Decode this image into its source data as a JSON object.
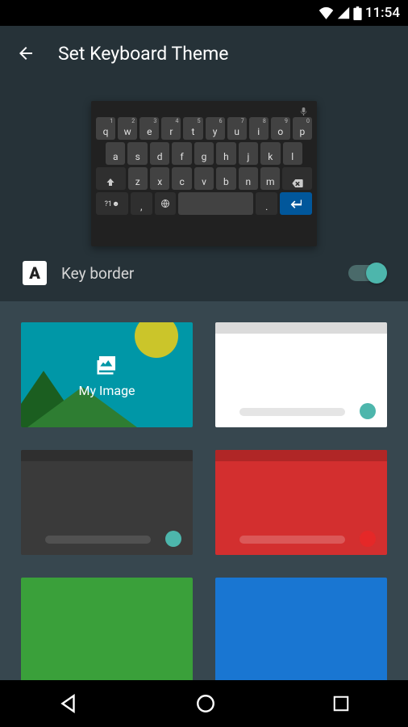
{
  "status": {
    "time": "11:54"
  },
  "header": {
    "title": "Set Keyboard Theme"
  },
  "keyboard": {
    "row1": [
      {
        "main": "q",
        "sup": "1"
      },
      {
        "main": "w",
        "sup": "2"
      },
      {
        "main": "e",
        "sup": "3"
      },
      {
        "main": "r",
        "sup": "4"
      },
      {
        "main": "t",
        "sup": "5"
      },
      {
        "main": "y",
        "sup": "6"
      },
      {
        "main": "u",
        "sup": "7"
      },
      {
        "main": "i",
        "sup": "8"
      },
      {
        "main": "o",
        "sup": "9"
      },
      {
        "main": "p",
        "sup": "0"
      }
    ],
    "row2": [
      "a",
      "s",
      "d",
      "f",
      "g",
      "h",
      "j",
      "k",
      "l"
    ],
    "row3": [
      "z",
      "x",
      "c",
      "v",
      "b",
      "n",
      "m"
    ],
    "row4": {
      "symKey": "?1☻",
      "comma": ","
    }
  },
  "toggle": {
    "icon_letter": "A",
    "label": "Key border",
    "on": true
  },
  "themes": {
    "myImageLabel": "My Image",
    "tiles": [
      {
        "type": "my-image"
      },
      {
        "type": "light",
        "dot": "teal"
      },
      {
        "type": "dark",
        "dot": "teal"
      },
      {
        "type": "red",
        "dot": "red"
      },
      {
        "type": "green-partial"
      },
      {
        "type": "blue-partial"
      }
    ]
  }
}
